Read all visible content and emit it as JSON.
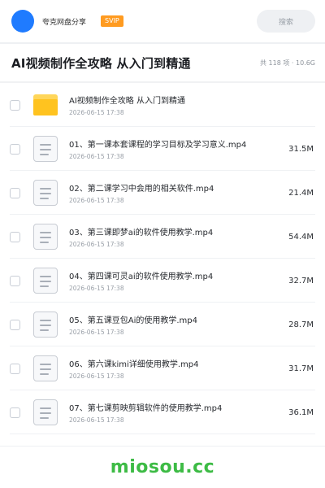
{
  "header": {
    "app_name": "夸克网盘分享",
    "badge": "SVIP",
    "search_label": "搜索"
  },
  "title_bar": {
    "title": "AI视频制作全攻略 从入门到精通",
    "meta": "共 118 项 · 10.6G"
  },
  "files": [
    {
      "name": "AI视频制作全攻略 从入门到精通",
      "date": "2026-06-15 17:38",
      "size": "",
      "type": "folder"
    },
    {
      "name": "01、第一课本套课程的学习目标及学习意义.mp4",
      "date": "2026-06-15 17:38",
      "size": "31.5M",
      "type": "file"
    },
    {
      "name": "02、第二课学习中会用的相关软件.mp4",
      "date": "2026-06-15 17:38",
      "size": "21.4M",
      "type": "file"
    },
    {
      "name": "03、第三课即梦ai的软件使用教学.mp4",
      "date": "2026-06-15 17:38",
      "size": "54.4M",
      "type": "file"
    },
    {
      "name": "04、第四课可灵ai的软件使用教学.mp4",
      "date": "2026-06-15 17:38",
      "size": "32.7M",
      "type": "file"
    },
    {
      "name": "05、第五课豆包Ai的使用教学.mp4",
      "date": "2026-06-15 17:38",
      "size": "28.7M",
      "type": "file"
    },
    {
      "name": "06、第六课kimi详细使用教学.mp4",
      "date": "2026-06-15 17:38",
      "size": "31.7M",
      "type": "file"
    },
    {
      "name": "07、第七课剪映剪辑软件的使用教学.mp4",
      "date": "2026-06-15 17:38",
      "size": "36.1M",
      "type": "file"
    }
  ],
  "footer": {
    "brand": "miosou.cc"
  },
  "colors": {
    "accent_blue": "#1f7bff",
    "svip_orange": "#ff9b20",
    "folder_yellow": "#ffc31f",
    "brand_green": "#3dbb45"
  }
}
